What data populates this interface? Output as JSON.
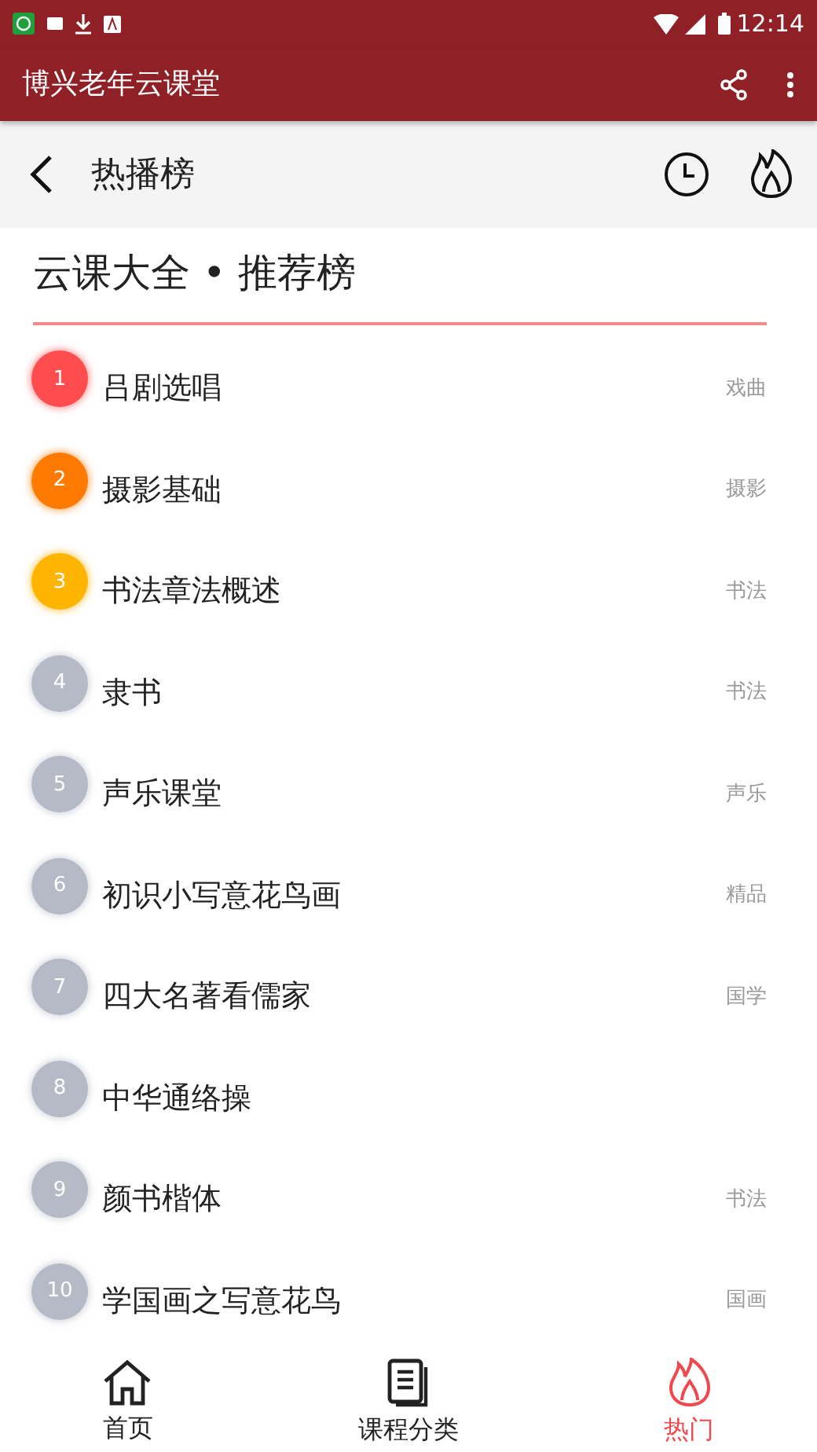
{
  "status_bar": {
    "time": "12:14"
  },
  "app_bar": {
    "title": "博兴老年云课堂"
  },
  "sub_header": {
    "title": "热播榜"
  },
  "list_title": "云课大全 • 推荐榜",
  "rows": [
    {
      "rank": "1",
      "title": "吕剧选唱",
      "tag": "戏曲",
      "color": "#ff4d4f"
    },
    {
      "rank": "2",
      "title": "摄影基础",
      "tag": "摄影",
      "color": "#ff7a00"
    },
    {
      "rank": "3",
      "title": "书法章法概述",
      "tag": "书法",
      "color": "#ffb400"
    },
    {
      "rank": "4",
      "title": "隶书",
      "tag": "书法",
      "color": "#b5bac6"
    },
    {
      "rank": "5",
      "title": "声乐课堂",
      "tag": "声乐",
      "color": "#b5bac6"
    },
    {
      "rank": "6",
      "title": "初识小写意花鸟画",
      "tag": "精品",
      "color": "#b5bac6"
    },
    {
      "rank": "7",
      "title": "四大名著看儒家",
      "tag": "国学",
      "color": "#b5bac6"
    },
    {
      "rank": "8",
      "title": "中华通络操",
      "color": "#b5bac6"
    },
    {
      "rank": "9",
      "title": "颜书楷体",
      "tag": "书法",
      "color": "#b5bac6"
    },
    {
      "rank": "10",
      "title": "学国画之写意花鸟",
      "tag": "国画",
      "color": "#b5bac6"
    }
  ],
  "bottom_nav": [
    {
      "kind": "home",
      "label": "首页",
      "selected": false
    },
    {
      "kind": "courses",
      "label": "课程分类",
      "selected": false
    },
    {
      "kind": "hot",
      "label": "热门",
      "selected": true
    }
  ]
}
